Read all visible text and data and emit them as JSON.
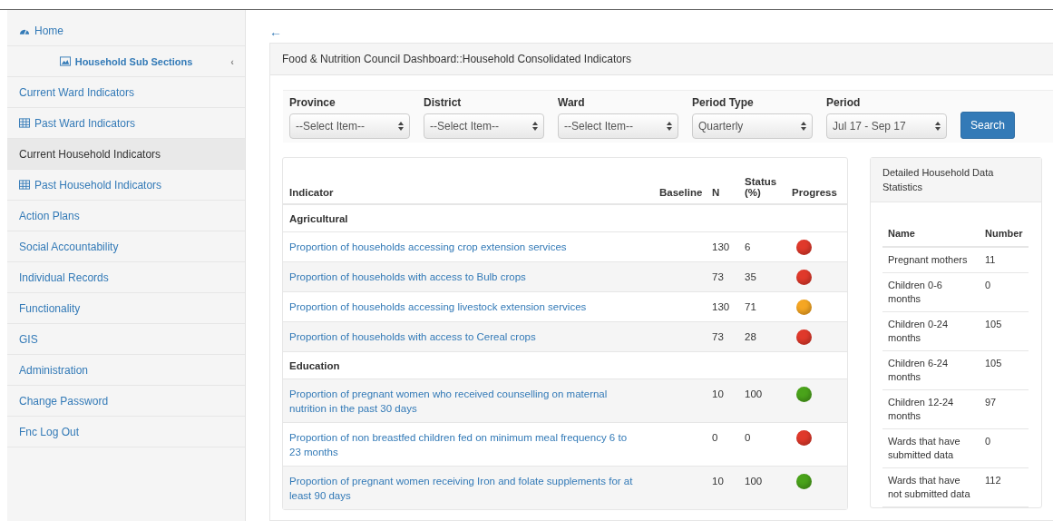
{
  "sidebar": {
    "items": [
      {
        "label": "Home",
        "kind": "home",
        "selected": false
      },
      {
        "label": "Household Sub Sections",
        "kind": "section",
        "caret": "‹",
        "selected": false
      },
      {
        "label": "Current Ward Indicators",
        "kind": "link",
        "selected": false
      },
      {
        "label": "Past Ward Indicators",
        "kind": "table-link",
        "selected": false
      },
      {
        "label": "Current Household Indicators",
        "kind": "link",
        "selected": true
      },
      {
        "label": "Past Household Indicators",
        "kind": "table-link",
        "selected": false
      },
      {
        "label": "Action Plans",
        "kind": "link",
        "selected": false
      },
      {
        "label": "Social Accountability",
        "kind": "link",
        "selected": false
      },
      {
        "label": "Individual Records",
        "kind": "link",
        "selected": false
      },
      {
        "label": "Functionality",
        "kind": "link",
        "selected": false
      },
      {
        "label": "GIS",
        "kind": "link",
        "selected": false
      },
      {
        "label": "Administration",
        "kind": "link",
        "selected": false
      },
      {
        "label": "Change Password",
        "kind": "link",
        "selected": false
      },
      {
        "label": "Fnc Log Out",
        "kind": "link",
        "selected": false
      }
    ]
  },
  "back": "←",
  "panel_title": "Food & Nutrition Council Dashboard::Household Consolidated Indicators",
  "filters": [
    {
      "label": "Province",
      "value": "--Select Item--"
    },
    {
      "label": "District",
      "value": "--Select Item--"
    },
    {
      "label": "Ward",
      "value": "--Select Item--"
    },
    {
      "label": "Period Type",
      "value": "Quarterly"
    },
    {
      "label": "Period",
      "value": "Jul 17 - Sep 17"
    }
  ],
  "search_button": "Search",
  "indicators": {
    "columns": [
      "Indicator",
      "Baseline",
      "N",
      "Status (%)",
      "Progress"
    ],
    "rows": [
      {
        "kind": "group",
        "label": "Agricultural"
      },
      {
        "kind": "indicator",
        "label": "Proportion of households accessing crop extension services",
        "n": "130",
        "status": "6",
        "color": "#e0392b"
      },
      {
        "kind": "indicator",
        "label": "Proportion of households with access to Bulb crops",
        "n": "73",
        "status": "35",
        "color": "#e0392b"
      },
      {
        "kind": "indicator",
        "label": "Proportion of households accessing livestock extension services",
        "n": "130",
        "status": "71",
        "color": "#f5a623"
      },
      {
        "kind": "indicator",
        "label": "Proportion of households with access to Cereal crops",
        "n": "73",
        "status": "28",
        "color": "#e0392b"
      },
      {
        "kind": "group",
        "label": "Education"
      },
      {
        "kind": "indicator",
        "label": "Proportion of pregnant women who received counselling on maternal nutrition in the past 30 days",
        "n": "10",
        "status": "100",
        "color": "#4aa31a"
      },
      {
        "kind": "indicator",
        "label": "Proportion of non breastfed children fed on minimum meal frequency 6 to 23 months",
        "n": "0",
        "status": "0",
        "color": "#e0392b"
      },
      {
        "kind": "indicator",
        "label": "Proportion of pregnant women receiving Iron and folate supplements for at least 90 days",
        "n": "10",
        "status": "100",
        "color": "#4aa31a"
      }
    ]
  },
  "statistics": {
    "title": "Detailed Household Data Statistics",
    "columns": [
      "Name",
      "Number"
    ],
    "rows": [
      {
        "name": "Pregnant mothers",
        "number": "11"
      },
      {
        "name": "Children 0-6 months",
        "number": "0"
      },
      {
        "name": "Children 0-24 months",
        "number": "105"
      },
      {
        "name": "Children 6-24 months",
        "number": "105"
      },
      {
        "name": "Children 12-24 months",
        "number": "97"
      },
      {
        "name": "Wards that have submitted data",
        "number": "0"
      },
      {
        "name": "Wards that have not submitted data",
        "number": "112"
      }
    ]
  }
}
